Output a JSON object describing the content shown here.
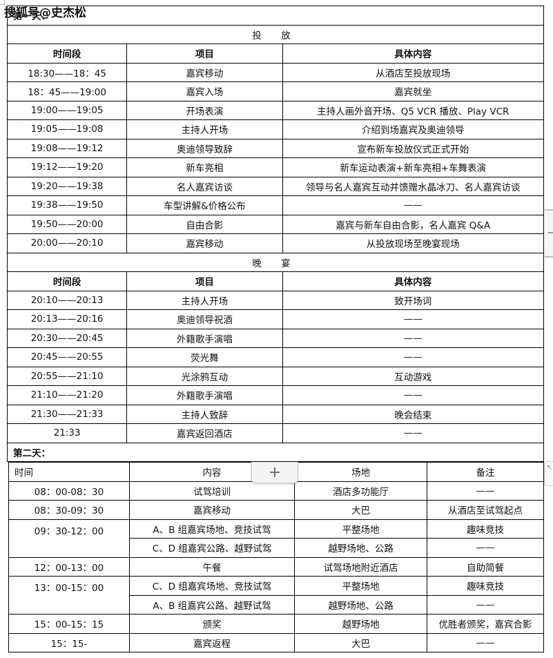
{
  "watermark": "搜狐号@史杰松",
  "day1": {
    "title": "第一天：",
    "sections": [
      {
        "name": "投 放",
        "headers": [
          "时间段",
          "项目",
          "具体内容"
        ],
        "rows": [
          [
            "18:30——18：45",
            "嘉宾移动",
            "从酒店至投放现场"
          ],
          [
            "18：45——19:00",
            "嘉宾入场",
            "嘉宾就坐"
          ],
          [
            "19:00——19:05",
            "开场表演",
            "主持人画外音开场、Q5 VCR 播放、Play VCR"
          ],
          [
            "19:05——19:08",
            "主持人开场",
            "介绍到场嘉宾及奥迪领导"
          ],
          [
            "19:08——19:12",
            "奥迪领导致辞",
            "宣布新车投放仪式正式开始"
          ],
          [
            "19:12——19:20",
            "新车亮相",
            "新车运动表演+新车亮相+车舞表演"
          ],
          [
            "19:20——19:38",
            "名人嘉宾访谈",
            "领导与名人嘉宾互动并馈赠水晶冰刀、名人嘉宾访谈"
          ],
          [
            "19:38——19:50",
            "车型讲解&价格公布",
            "——"
          ],
          [
            "19:50——20:00",
            "自由合影",
            "嘉宾与新车自由合影，名人嘉宾 Q&A"
          ],
          [
            "20:00——20:10",
            "嘉宾移动",
            "从投放现场至晚宴现场"
          ]
        ]
      },
      {
        "name": "晚 宴",
        "headers": [
          "时间段",
          "项目",
          "具体内容"
        ],
        "rows": [
          [
            "20:10——20:13",
            "主持人开场",
            "致开场词"
          ],
          [
            "20:13——20:16",
            "奥迪领导祝酒",
            "——"
          ],
          [
            "20:30——20:45",
            "外籍歌手演唱",
            "——"
          ],
          [
            "20:45——20:55",
            "荧光舞",
            "——"
          ],
          [
            "20:55——21:10",
            "光涂鸦互动",
            "互动游戏"
          ],
          [
            "21:10——21:20",
            "外籍歌手演唱",
            "——"
          ],
          [
            "21:30——21:33",
            "主持人致辞",
            "晚会结束"
          ],
          [
            "21:33",
            "嘉宾返回酒店",
            "——"
          ]
        ]
      }
    ]
  },
  "day2": {
    "title": "第二天：",
    "headers": [
      "时间",
      "内容",
      "场地",
      "备注"
    ],
    "rows": [
      {
        "time": "08：00-08：30",
        "items": [
          [
            "试驾培训",
            "酒店多功能厅",
            "——"
          ]
        ]
      },
      {
        "time": "08：30-09：30",
        "items": [
          [
            "嘉宾移动",
            "大巴",
            "从酒店至试驾起点"
          ]
        ]
      },
      {
        "time": "09：30-12：00",
        "items": [
          [
            "A、B 组嘉宾场地、竞技试驾",
            "平整场地",
            "趣味竞技"
          ],
          [
            "C、D 组嘉宾公路、越野试驾",
            "越野场地、公路",
            "——"
          ]
        ]
      },
      {
        "time": "12：00-13：00",
        "items": [
          [
            "午餐",
            "试驾场地附近酒店",
            "自助简餐"
          ]
        ]
      },
      {
        "time": "13：00-15：00",
        "items": [
          [
            "C、D 组嘉宾场地、竞技试驾",
            "平整场地",
            "趣味竞技"
          ],
          [
            "A、B 组嘉宾公路、越野试驾",
            "越野场地、公路",
            "——"
          ]
        ]
      },
      {
        "time": "15：00-15：15",
        "items": [
          [
            "颁奖",
            "越野场地",
            "优胜者颁奖，嘉宾合影"
          ]
        ]
      },
      {
        "time": "15：15-",
        "items": [
          [
            "嘉宾返程",
            "大巴",
            "——"
          ]
        ]
      }
    ]
  },
  "ui": {
    "add_row_button": "+",
    "add_row_icon": "plus-icon",
    "side_handle_icon": "resize-arrow-icon",
    "side_handle_glyph": "↖"
  }
}
